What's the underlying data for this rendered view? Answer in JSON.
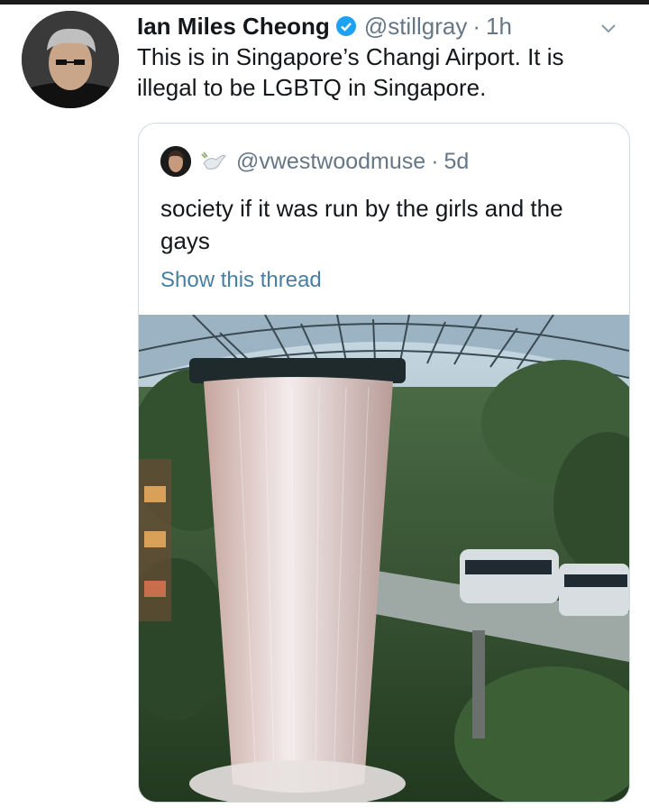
{
  "tweet": {
    "author_name": "Ian Miles Cheong",
    "handle": "@stillgray",
    "separator": "·",
    "time": "1h",
    "text": "This is in Singapore’s Changi Airport. It is illegal to be LGBTQ in Singapore."
  },
  "quoted_tweet": {
    "handle": "@vwestwoodmuse",
    "separator": "·",
    "time": "5d",
    "text": "society if it was run by the girls and the gays",
    "thread_link": "Show this thread"
  },
  "icons": {
    "verified": "verified-badge-icon",
    "menu": "chevron-down-icon",
    "emoji": "dove-emoji-icon"
  },
  "colors": {
    "link": "#1da1f2",
    "verified": "#1da1f2",
    "secondary_text": "#657786",
    "border": "#cfd9de"
  }
}
